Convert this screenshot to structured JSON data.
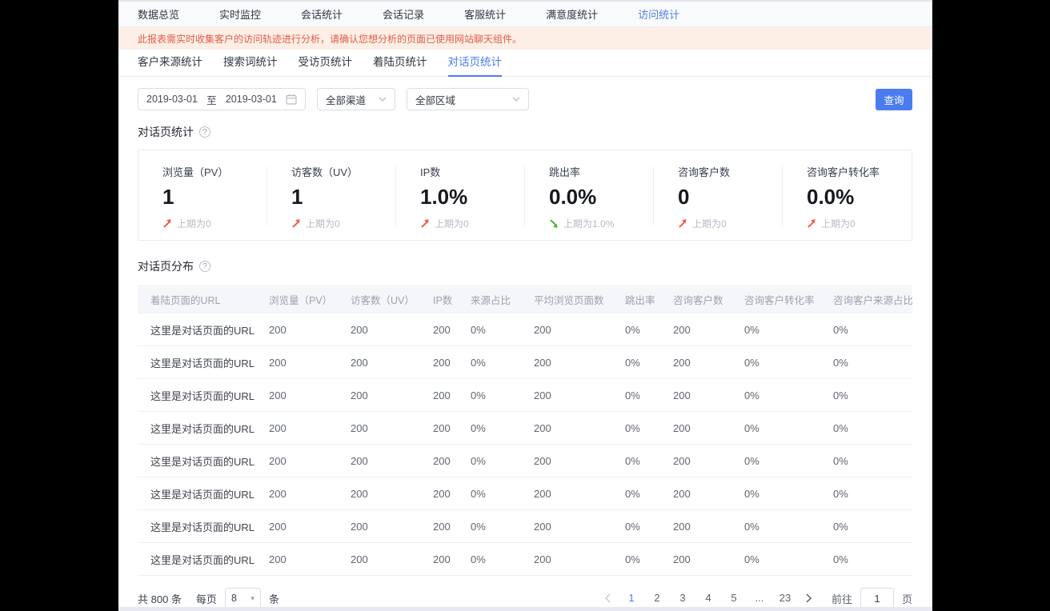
{
  "colors": {
    "accent": "#4a7cf0",
    "trend_up": "#f15a4a",
    "trend_down": "#44b626"
  },
  "top_nav": {
    "items": [
      {
        "label": "数据总览",
        "active": false
      },
      {
        "label": "实时监控",
        "active": false
      },
      {
        "label": "会话统计",
        "active": false
      },
      {
        "label": "会话记录",
        "active": false
      },
      {
        "label": "客服统计",
        "active": false
      },
      {
        "label": "满意度统计",
        "active": false
      },
      {
        "label": "访问统计",
        "active": true
      }
    ]
  },
  "banner": {
    "text": "此报表需实时收集客户的访问轨迹进行分析，请确认您想分析的页面已使用网站聊天组件。"
  },
  "sub_tabs": {
    "items": [
      {
        "label": "客户来源统计",
        "active": false
      },
      {
        "label": "搜索词统计",
        "active": false
      },
      {
        "label": "受访页统计",
        "active": false
      },
      {
        "label": "着陆页统计",
        "active": false
      },
      {
        "label": "对话页统计",
        "active": true
      }
    ]
  },
  "filters": {
    "date_start": "2019-03-01",
    "date_separator": "至",
    "date_end": "2019-03-01",
    "channel": "全部渠道",
    "region": "全部区域",
    "query_label": "查询"
  },
  "sections": {
    "stats_title": "对话页统计",
    "dist_title": "对话页分布"
  },
  "help_icon_char": "?",
  "stats": [
    {
      "label": "浏览量（PV）",
      "value": "1",
      "trend": "up",
      "delta": "上期为0"
    },
    {
      "label": "访客数（UV）",
      "value": "1",
      "trend": "up",
      "delta": "上期为0"
    },
    {
      "label": "IP数",
      "value": "1.0%",
      "trend": "up",
      "delta": "上期为0"
    },
    {
      "label": "跳出率",
      "value": "0.0%",
      "trend": "down",
      "delta": "上期为1.0%"
    },
    {
      "label": "咨询客户数",
      "value": "0",
      "trend": "up",
      "delta": "上期为0"
    },
    {
      "label": "咨询客户转化率",
      "value": "0.0%",
      "trend": "up",
      "delta": "上期为0"
    }
  ],
  "table": {
    "columns": [
      "着陆页面的URL",
      "浏览量（PV）",
      "访客数（UV）",
      "IP数",
      "来源占比",
      "平均浏览页面数",
      "跳出率",
      "咨询客户数",
      "咨询客户转化率",
      "咨询客户来源占比"
    ],
    "rows": [
      [
        "这里是对话页面的URL",
        "200",
        "200",
        "200",
        "0%",
        "200",
        "0%",
        "200",
        "0%",
        "0%"
      ],
      [
        "这里是对话页面的URL",
        "200",
        "200",
        "200",
        "0%",
        "200",
        "0%",
        "200",
        "0%",
        "0%"
      ],
      [
        "这里是对话页面的URL",
        "200",
        "200",
        "200",
        "0%",
        "200",
        "0%",
        "200",
        "0%",
        "0%"
      ],
      [
        "这里是对话页面的URL",
        "200",
        "200",
        "200",
        "0%",
        "200",
        "0%",
        "200",
        "0%",
        "0%"
      ],
      [
        "这里是对话页面的URL",
        "200",
        "200",
        "200",
        "0%",
        "200",
        "0%",
        "200",
        "0%",
        "0%"
      ],
      [
        "这里是对话页面的URL",
        "200",
        "200",
        "200",
        "0%",
        "200",
        "0%",
        "200",
        "0%",
        "0%"
      ],
      [
        "这里是对话页面的URL",
        "200",
        "200",
        "200",
        "0%",
        "200",
        "0%",
        "200",
        "0%",
        "0%"
      ],
      [
        "这里是对话页面的URL",
        "200",
        "200",
        "200",
        "0%",
        "200",
        "0%",
        "200",
        "0%",
        "0%"
      ]
    ]
  },
  "footer": {
    "total": "共 800 条",
    "per_page_label": "每页",
    "page_size": "8",
    "unit": "条"
  },
  "pagination": {
    "pages": [
      "1",
      "2",
      "3",
      "4",
      "5",
      "...",
      "23"
    ],
    "active_index": 0,
    "goto_label": "前往",
    "goto_value": "1",
    "goto_unit": "页"
  }
}
